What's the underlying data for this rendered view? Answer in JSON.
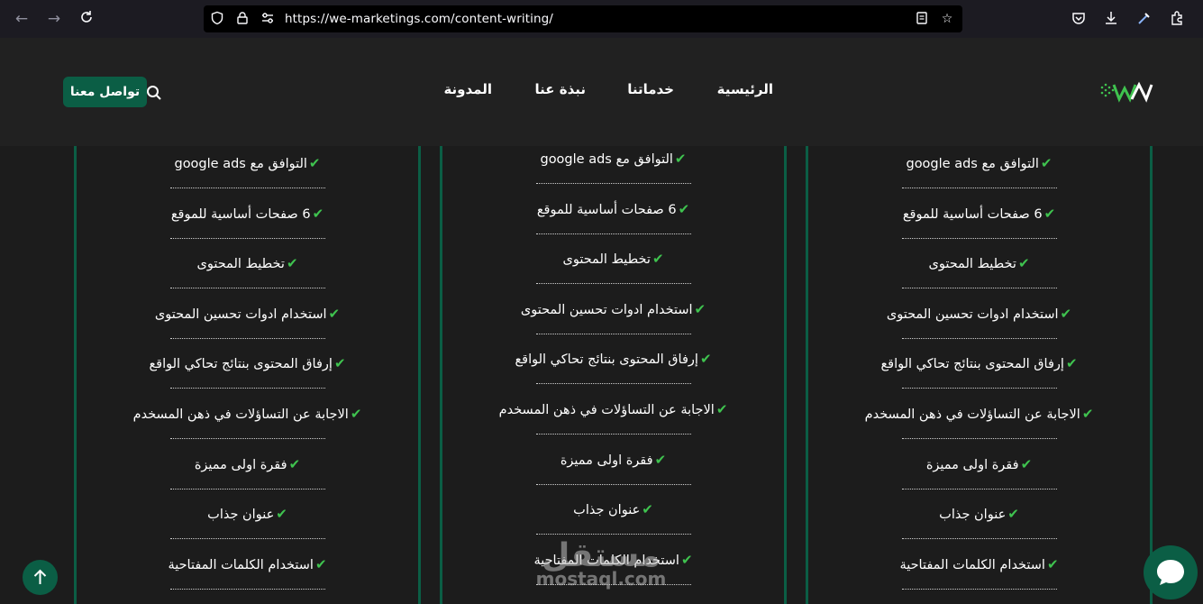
{
  "browser": {
    "url": "https://we-marketings.com/content-writing/"
  },
  "header": {
    "nav": [
      "الرئيسية",
      "خدماتنا",
      "نبذة عنا",
      "المدونة"
    ],
    "contact_label": "تواصل معنا"
  },
  "columns": [
    {
      "features": [
        "التوافق مع google ads",
        "6 صفحات أساسية للموقع",
        "تخطيط المحتوى",
        "استخدام ادوات تحسين المحتوى",
        "إرفاق المحتوى بنتائج تحاكي الواقع",
        "الاجابة عن التساؤلات في ذهن المسخدم",
        "فقرة اولى مميزة",
        "عنوان جذاب",
        "استخدام الكلمات المفتاحية"
      ]
    },
    {
      "features": [
        "التوافق مع google ads",
        "6 صفحات أساسية للموقع",
        "تخطيط المحتوى",
        "استخدام ادوات تحسين المحتوى",
        "إرفاق المحتوى بنتائج تحاكي الواقع",
        "الاجابة عن التساؤلات في ذهن المسخدم",
        "فقرة اولى مميزة",
        "عنوان جذاب",
        "استخدام الكلمات المفتاحية"
      ]
    },
    {
      "features": [
        "التوافق مع google ads",
        "6 صفحات أساسية للموقع",
        "تخطيط المحتوى",
        "استخدام ادوات تحسين المحتوى",
        "إرفاق المحتوى بنتائج تحاكي الواقع",
        "الاجابة عن التساؤلات في ذهن المسخدم",
        "فقرة اولى مميزة",
        "عنوان جذاب",
        "استخدام الكلمات المفتاحية"
      ]
    }
  ],
  "check_mark": "✔",
  "watermark": {
    "arabic": "مستقل",
    "latin": "mostaql.com"
  },
  "colors": {
    "accent": "#0b5e45",
    "check": "#3fc34f",
    "background": "#1c1c1c",
    "header": "#212121"
  }
}
